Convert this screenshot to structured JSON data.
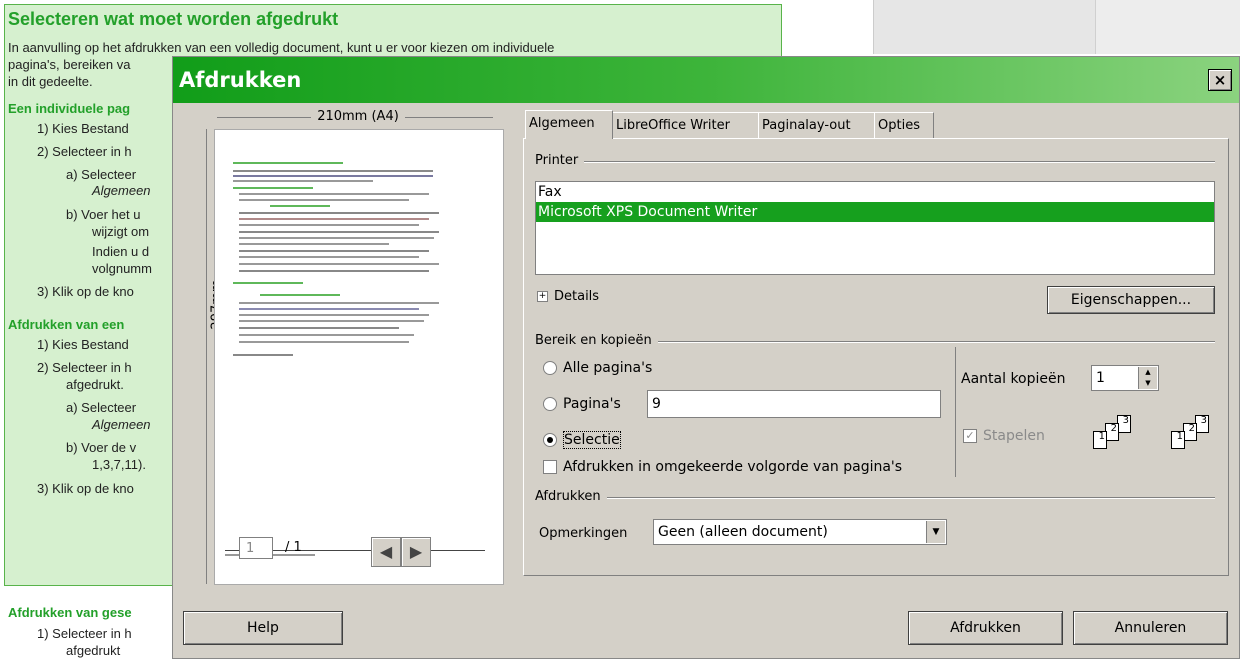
{
  "background_doc": {
    "heading": "Selecteren wat moet worden afgedrukt",
    "intro_lines": [
      "In aanvulling op het afdrukken van een volledig document, kunt u er voor kiezen om individuele",
      "pagina's, bereiken va",
      "in dit gedeelte."
    ],
    "sec1": "Een individuele pag",
    "items1": [
      "1)  Kies Bestand",
      "2)  Selecteer in h",
      "a)  Selecteer",
      "Algemeen",
      "b)  Voer het u",
      "wijzigt om",
      "Indien u d",
      "volgnumm",
      "3)  Klik op de kno"
    ],
    "sec2": "Afdrukken van een",
    "items2": [
      "1)  Kies Bestand",
      "2)  Selecteer in h",
      "afgedrukt.",
      "a)  Selecteer",
      "Algemeen",
      "b)  Voer de v",
      "1,3,7,11).",
      "3)  Klik op de kno"
    ],
    "sec3": "Afdrukken van gese",
    "items3": [
      "1)  Selecteer in h",
      "afgedrukt"
    ]
  },
  "dialog": {
    "title": "Afdrukken",
    "close": "×",
    "preview": {
      "paper_width": "210mm (A4)",
      "paper_height": "297mm",
      "page_value": "1",
      "page_total": "/ 1"
    },
    "tabs": [
      "Algemeen",
      "LibreOffice Writer",
      "Paginalay-out",
      "Opties"
    ],
    "printer": {
      "legend": "Printer",
      "items": [
        "Fax",
        "Microsoft XPS Document Writer"
      ],
      "selected_index": 1,
      "details": "Details",
      "properties_button": "Eigenschappen..."
    },
    "range": {
      "legend": "Bereik en kopieën",
      "all_pages": "Alle pagina's",
      "pages": "Pagina's",
      "pages_value": "9",
      "selection": "Selectie",
      "selected_option": "selection",
      "reverse_order": "Afdrukken in omgekeerde volgorde van pagina's",
      "copies_label": "Aantal kopieën",
      "copies_value": "1",
      "collate": "Stapelen",
      "collate_checked": true
    },
    "print_section": {
      "legend": "Afdrukken",
      "comments_label": "Opmerkingen",
      "comments_value": "Geen (alleen document)"
    },
    "buttons": {
      "help": "Help",
      "print": "Afdrukken",
      "cancel": "Annuleren"
    }
  },
  "colors": {
    "title_gradient_start": "#119d19",
    "selection_green": "#16a01e",
    "dialog_face": "#d4d0c8",
    "doc_heading_green": "#23a02a"
  }
}
